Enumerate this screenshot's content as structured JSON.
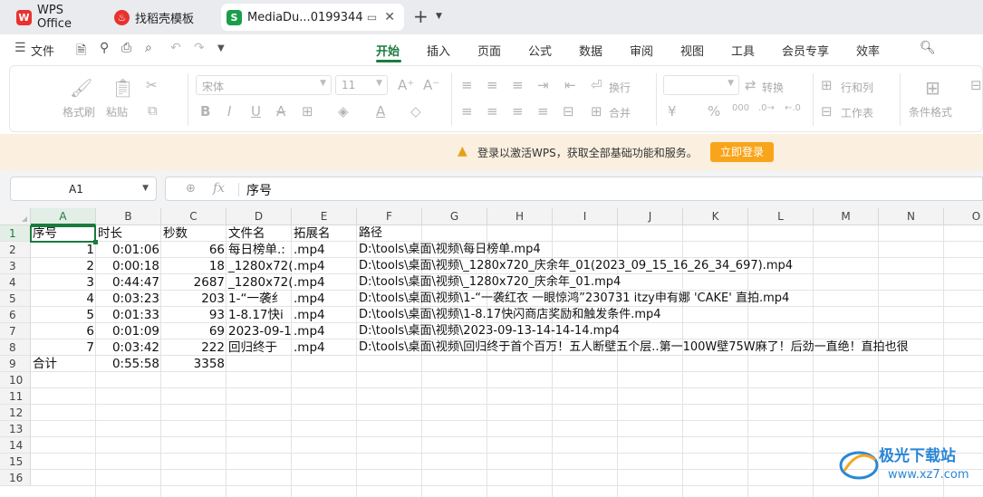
{
  "tabs": [
    {
      "label": "WPS Office",
      "icon": "wps-logo-icon",
      "color": "#e8322f"
    },
    {
      "label": "找稻壳模板",
      "icon": "daoke-icon",
      "color": "#e8322f"
    },
    {
      "label": "MediaDu...0199344",
      "icon": "sheet-icon",
      "color": "#1b9e4b",
      "active": true
    }
  ],
  "menu": {
    "file": "文件",
    "tabs": [
      "开始",
      "插入",
      "页面",
      "公式",
      "数据",
      "审阅",
      "视图",
      "工具",
      "会员专享",
      "效率"
    ],
    "active": "开始"
  },
  "ribbon": {
    "format_painter": "格式刷",
    "paste": "粘贴",
    "font_name": "宋体",
    "font_size": "11",
    "wrap": "换行",
    "merge": "合并",
    "convert": "转换",
    "rows_cols": "行和列",
    "worksheet": "工作表",
    "cond_format": "条件格式"
  },
  "notice": {
    "message": "登录以激活WPS，获取全部基础功能和服务。",
    "button": "立即登录"
  },
  "formula_bar": {
    "name_box": "A1",
    "fx": "fx",
    "value": "序号"
  },
  "columns": [
    "A",
    "B",
    "C",
    "D",
    "E",
    "F",
    "G",
    "H",
    "I",
    "J",
    "K",
    "L",
    "M",
    "N",
    "O"
  ],
  "rows": [
    "1",
    "2",
    "3",
    "4",
    "5",
    "6",
    "7",
    "8",
    "9",
    "10",
    "11",
    "12",
    "13",
    "14",
    "15",
    "16"
  ],
  "table": {
    "header": [
      "序号",
      "时长",
      "秒数",
      "文件名",
      "拓展名",
      "路径"
    ],
    "data": [
      [
        "1",
        "0:01:06",
        "66",
        "每日榜单.:",
        ".mp4",
        "D:\\tools\\桌面\\视频\\每日榜单.mp4"
      ],
      [
        "2",
        "0:00:18",
        "18",
        "_1280x72(",
        ".mp4",
        "D:\\tools\\桌面\\视频\\_1280x720_庆余年_01(2023_09_15_16_26_34_697).mp4"
      ],
      [
        "3",
        "0:44:47",
        "2687",
        "_1280x72(",
        ".mp4",
        "D:\\tools\\桌面\\视频\\_1280x720_庆余年_01.mp4"
      ],
      [
        "4",
        "0:03:23",
        "203",
        "1-“一袭纟",
        ".mp4",
        "D:\\tools\\桌面\\视频\\1-“一袭红衣 一眼惊鸿”230731 itzy申有娜 'CAKE' 直拍.mp4"
      ],
      [
        "5",
        "0:01:33",
        "93",
        "1-8.17快i",
        ".mp4",
        "D:\\tools\\桌面\\视频\\1-8.17快闪商店奖励和触发条件.mp4"
      ],
      [
        "6",
        "0:01:09",
        "69",
        "2023-09-1",
        ".mp4",
        "D:\\tools\\桌面\\视频\\2023-09-13-14-14-14.mp4"
      ],
      [
        "7",
        "0:03:42",
        "222",
        "回归终于",
        ".mp4",
        "D:\\tools\\桌面\\视频\\回归终于首个百万！五人断壁五个层..第一100W壁75W麻了！后劲一直绝！直拍也很"
      ]
    ],
    "total": [
      "合计",
      "0:55:58",
      "3358"
    ]
  },
  "watermark": {
    "brand": "极光下载站",
    "url": "www.xz7.com"
  },
  "colors": {
    "accent": "#1b7b3e",
    "notice_bg": "#fbefdf",
    "login_btn": "#f8a51b"
  }
}
